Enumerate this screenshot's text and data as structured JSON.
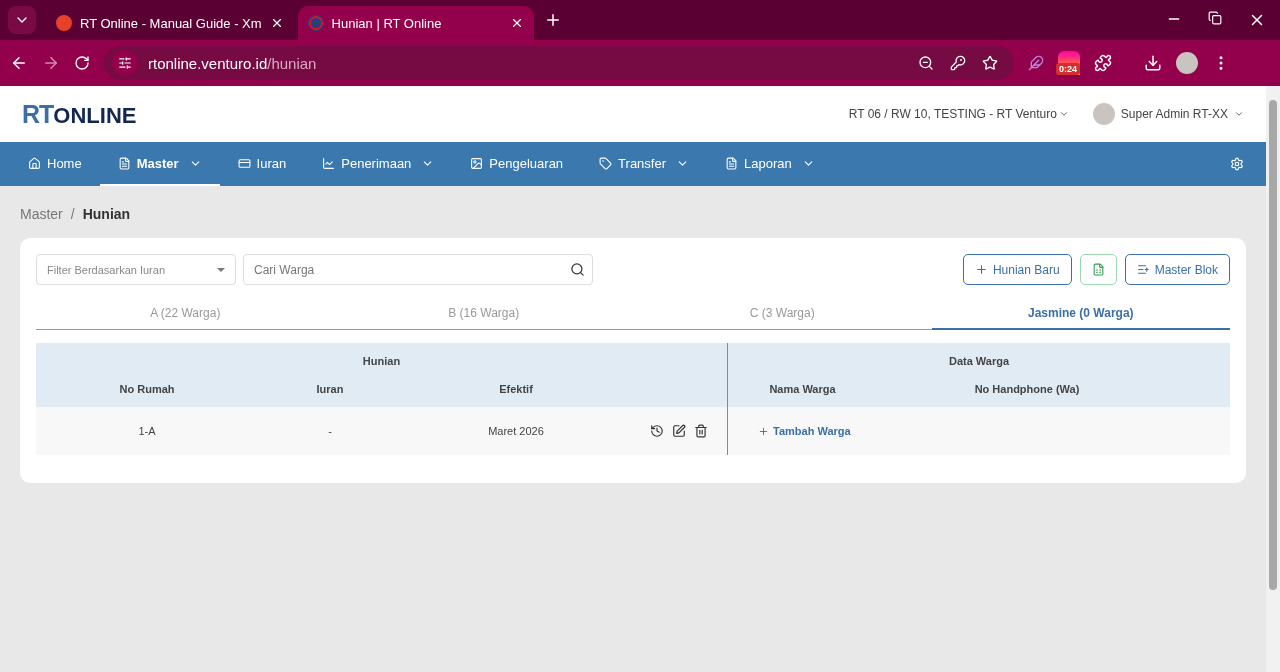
{
  "browser": {
    "tabs": [
      {
        "title": "RT Online - Manual Guide - Xm",
        "selected": false
      },
      {
        "title": "Hunian | RT Online",
        "selected": true
      }
    ],
    "url": {
      "host": "rtonline.venturo.id",
      "path": "/hunian"
    },
    "extension_badge": "0:24"
  },
  "header": {
    "logo": {
      "first": "RT",
      "second": "ONLINE"
    },
    "organization": "RT 06 / RW 10, TESTING - RT Venturo",
    "user": "Super Admin RT-XX"
  },
  "nav": [
    {
      "label": "Home",
      "dropdown": false,
      "selected": false
    },
    {
      "label": "Master",
      "dropdown": true,
      "selected": true
    },
    {
      "label": "Iuran",
      "dropdown": false,
      "selected": false
    },
    {
      "label": "Penerimaan",
      "dropdown": true,
      "selected": false
    },
    {
      "label": "Pengeluaran",
      "dropdown": false,
      "selected": false
    },
    {
      "label": "Transfer",
      "dropdown": true,
      "selected": false
    },
    {
      "label": "Laporan",
      "dropdown": true,
      "selected": false
    }
  ],
  "breadcrumb": {
    "parent": "Master",
    "separator": "/",
    "current": "Hunian"
  },
  "filter": {
    "placeholder": "Filter Berdasarkan Iuran"
  },
  "search": {
    "placeholder": "Cari Warga"
  },
  "actions": [
    {
      "kind": "add",
      "label": "Hunian Baru"
    },
    {
      "kind": "excel"
    },
    {
      "kind": "list",
      "label": "Master Blok"
    }
  ],
  "blocks": [
    {
      "label": "A (22 Warga)",
      "selected": false
    },
    {
      "label": "B (16 Warga)",
      "selected": false
    },
    {
      "label": "C (3 Warga)",
      "selected": false
    },
    {
      "label": "Jasmine (0 Warga)",
      "selected": true
    }
  ],
  "table": {
    "groups": [
      "Hunian",
      "Data Warga"
    ],
    "columns": [
      "No Rumah",
      "Iuran",
      "Efektif",
      "Nama Warga",
      "No Handphone (Wa)"
    ],
    "rows": [
      {
        "no_rumah": "1-A",
        "iuran": "-",
        "efektif": "Maret 2026",
        "add_label": "Tambah Warga"
      }
    ]
  }
}
